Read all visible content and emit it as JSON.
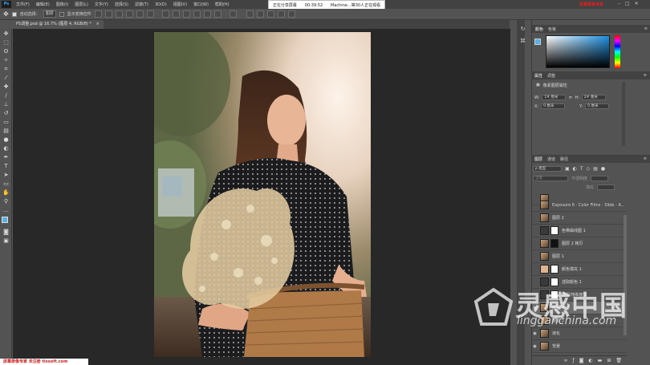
{
  "app": {
    "logo": "Ps",
    "menu": [
      "文件(F)",
      "编辑(E)",
      "图像(I)",
      "图层(L)",
      "文字(Y)",
      "选择(S)",
      "滤镜(T)",
      "3D(D)",
      "视图(V)",
      "窗口(W)",
      "帮助(H)"
    ]
  },
  "share": {
    "status": "正在分享屏幕",
    "time": "00:39:52",
    "viewers": "Machine...等30人正在观看"
  },
  "recording": {
    "label": "屏幕录像专家"
  },
  "options": {
    "auto_select_label": "自动选择：",
    "auto_select_value": "图层",
    "show_transform_label": "显示变换控件"
  },
  "document": {
    "tab_title": "PS调整.psd @ 16.7% (图层 4, RGB/8) *"
  },
  "panels": {
    "color": {
      "tab_active": "颜色",
      "tab_other": "色板"
    },
    "properties": {
      "tab_active": "属性",
      "tab_other": "调整",
      "title": "像素图层属性",
      "w_label": "W:",
      "w_value": "1# 厘米",
      "h_label": "H:",
      "h_value": "2# 厘米",
      "x_label": "X:",
      "x_value": "0 厘米",
      "y_label": "Y:",
      "y_value": "0 厘米"
    },
    "layers": {
      "tab_active": "图层",
      "tab_channels": "通道",
      "tab_paths": "路径",
      "filter_value": "ρ 类型",
      "blend_mode": "正常",
      "opacity_label": "不透明度",
      "fill_label": "填充",
      "items": [
        {
          "name": "",
          "visible": false,
          "selected": false,
          "thumb": "photo",
          "mask": false,
          "partial": true
        },
        {
          "name": "Exposure 6 - Color Films - Slide - A...",
          "visible": false,
          "selected": false,
          "thumb": "photo",
          "mask": false
        },
        {
          "name": "图层 2",
          "visible": false,
          "selected": false,
          "thumb": "photo",
          "mask": false
        },
        {
          "name": "色带曲线图 1",
          "visible": false,
          "selected": false,
          "thumb": "adjust",
          "mask": true
        },
        {
          "name": "图层 2 拷贝",
          "visible": false,
          "selected": false,
          "thumb": "photo",
          "mask": true,
          "dark_mask": true
        },
        {
          "name": "图层 1",
          "visible": false,
          "selected": false,
          "thumb": "photo",
          "mask": false
        },
        {
          "name": "颜色填充 1",
          "visible": false,
          "selected": false,
          "thumb": "fill",
          "mask": true
        },
        {
          "name": "选取颜色 1",
          "visible": false,
          "selected": false,
          "thumb": "adjust",
          "mask": true
        },
        {
          "name": "色相/饱和度 1",
          "visible": false,
          "selected": false,
          "thumb": "adjust",
          "mask": true
        },
        {
          "name": "图层 4",
          "visible": true,
          "selected": true,
          "thumb": "photo",
          "mask": false
        },
        {
          "name": "图层 3",
          "visible": false,
          "selected": false,
          "thumb": "photo",
          "mask": false
        },
        {
          "name": "液化",
          "visible": true,
          "selected": false,
          "thumb": "photo",
          "mask": false
        },
        {
          "name": "背景",
          "visible": true,
          "selected": false,
          "thumb": "photo",
          "mask": false
        }
      ]
    }
  },
  "watermark": {
    "cn": "灵感中国",
    "en": "lingganchina.com"
  },
  "footer": {
    "text": "屏幕录像专家 未注册 tlxsoft.com"
  },
  "colors": {
    "fg": "#54b2e6",
    "bg": "#54b2e6",
    "ui_dark": "#424242",
    "ui_mid": "#535353",
    "canvas": "#282828"
  },
  "icons": [
    "move-icon",
    "marquee-icon",
    "lasso-icon",
    "magic-wand-icon",
    "crop-icon",
    "eyedropper-icon",
    "healing-icon",
    "brush-icon",
    "stamp-icon",
    "history-brush-icon",
    "eraser-icon",
    "gradient-icon",
    "blur-icon",
    "dodge-icon",
    "pen-icon",
    "type-icon",
    "path-select-icon",
    "rectangle-icon",
    "hand-icon",
    "zoom-icon"
  ]
}
